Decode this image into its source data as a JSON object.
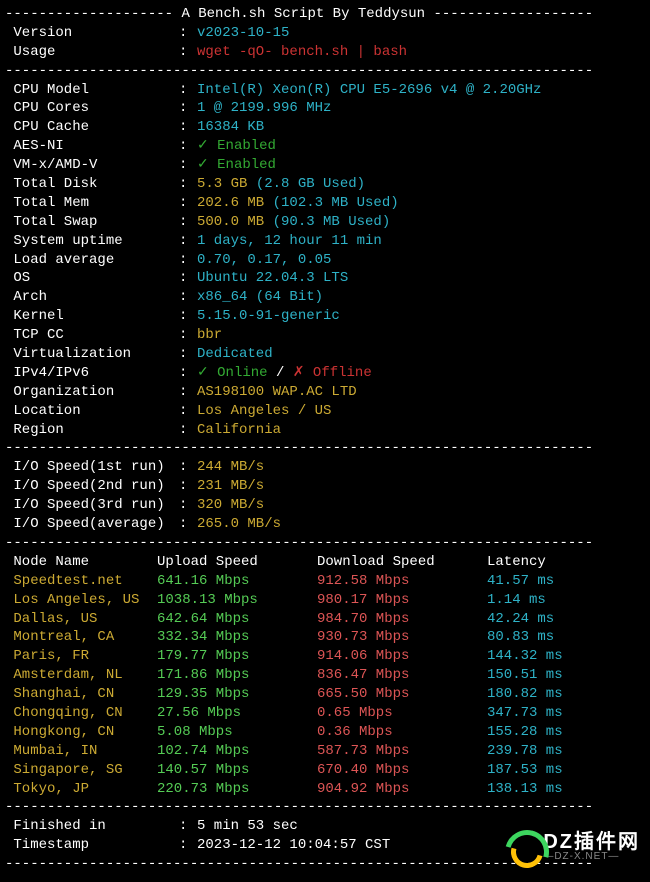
{
  "header": {
    "title_prefix": "-------------------- ",
    "title": "A Bench.sh Script By Teddysun",
    "title_suffix": " -------------------",
    "version_label": " Version",
    "version_value": "v2023-10-15",
    "usage_label": " Usage",
    "usage_value": "wget -qO- bench.sh | bash"
  },
  "divider": "----------------------------------------------------------------------",
  "colon": ": ",
  "system": {
    "cpu_model_label": " CPU Model",
    "cpu_model_value": "Intel(R) Xeon(R) CPU E5-2696 v4 @ 2.20GHz",
    "cpu_cores_label": " CPU Cores",
    "cpu_cores_value": "1 @ 2199.996 MHz",
    "cpu_cache_label": " CPU Cache",
    "cpu_cache_value": "16384 KB",
    "aes_label": " AES-NI",
    "aes_check": "✓ ",
    "aes_value": "Enabled",
    "vmx_label": " VM-x/AMD-V",
    "vmx_check": "✓ ",
    "vmx_value": "Enabled",
    "disk_label": " Total Disk",
    "disk_value": "5.3 GB",
    "disk_used": " (2.8 GB Used)",
    "mem_label": " Total Mem",
    "mem_value": "202.6 MB",
    "mem_used": " (102.3 MB Used)",
    "swap_label": " Total Swap",
    "swap_value": "500.0 MB",
    "swap_used": " (90.3 MB Used)",
    "uptime_label": " System uptime",
    "uptime_value": "1 days, 12 hour 11 min",
    "load_label": " Load average",
    "load_value": "0.70, 0.17, 0.05",
    "os_label": " OS",
    "os_value": "Ubuntu 22.04.3 LTS",
    "arch_label": " Arch",
    "arch_value": "x86_64 (64 Bit)",
    "kernel_label": " Kernel",
    "kernel_value": "5.15.0-91-generic",
    "tcp_label": " TCP CC",
    "tcp_value": "bbr",
    "virt_label": " Virtualization",
    "virt_value": "Dedicated",
    "ipv_label": " IPv4/IPv6",
    "ipv4_check": "✓ ",
    "ipv4_value": "Online",
    "ipv_sep": " / ",
    "ipv6_check": "✗ ",
    "ipv6_value": "Offline",
    "org_label": " Organization",
    "org_value": "AS198100 WAP.AC LTD",
    "loc_label": " Location",
    "loc_value": "Los Angeles / US",
    "region_label": " Region",
    "region_value": "California"
  },
  "io": {
    "run1_label": " I/O Speed(1st run)",
    "run1_value": "244 MB/s",
    "run2_label": " I/O Speed(2nd run)",
    "run2_value": "231 MB/s",
    "run3_label": " I/O Speed(3rd run)",
    "run3_value": "320 MB/s",
    "avg_label": " I/O Speed(average)",
    "avg_value": "265.0 MB/s"
  },
  "speedtest": {
    "header_name": " Node Name",
    "header_upload": "Upload Speed",
    "header_download": "Download Speed",
    "header_latency": "Latency",
    "rows": [
      {
        "name": " Speedtest.net",
        "up": "641.16 Mbps",
        "down": "912.58 Mbps",
        "lat": "41.57 ms"
      },
      {
        "name": " Los Angeles, US",
        "up": "1038.13 Mbps",
        "down": "980.17 Mbps",
        "lat": "1.14 ms"
      },
      {
        "name": " Dallas, US",
        "up": "642.64 Mbps",
        "down": "984.70 Mbps",
        "lat": "42.24 ms"
      },
      {
        "name": " Montreal, CA",
        "up": "332.34 Mbps",
        "down": "930.73 Mbps",
        "lat": "80.83 ms"
      },
      {
        "name": " Paris, FR",
        "up": "179.77 Mbps",
        "down": "914.06 Mbps",
        "lat": "144.32 ms"
      },
      {
        "name": " Amsterdam, NL",
        "up": "171.86 Mbps",
        "down": "836.47 Mbps",
        "lat": "150.51 ms"
      },
      {
        "name": " Shanghai, CN",
        "up": "129.35 Mbps",
        "down": "665.50 Mbps",
        "lat": "180.82 ms"
      },
      {
        "name": " Chongqing, CN",
        "up": "27.56 Mbps",
        "down": "0.65 Mbps",
        "lat": "347.73 ms"
      },
      {
        "name": " Hongkong, CN",
        "up": "5.08 Mbps",
        "down": "0.36 Mbps",
        "lat": "155.28 ms"
      },
      {
        "name": " Mumbai, IN",
        "up": "102.74 Mbps",
        "down": "587.73 Mbps",
        "lat": "239.78 ms"
      },
      {
        "name": " Singapore, SG",
        "up": "140.57 Mbps",
        "down": "670.40 Mbps",
        "lat": "187.53 ms"
      },
      {
        "name": " Tokyo, JP",
        "up": "220.73 Mbps",
        "down": "904.92 Mbps",
        "lat": "138.13 ms"
      }
    ]
  },
  "footer": {
    "finished_label": " Finished in",
    "finished_value": "5 min 53 sec",
    "timestamp_label": " Timestamp",
    "timestamp_value": "2023-12-12 10:04:57 CST"
  },
  "watermark": {
    "top": "DZ插件网",
    "bottom": "—DZ-X.NET—"
  }
}
